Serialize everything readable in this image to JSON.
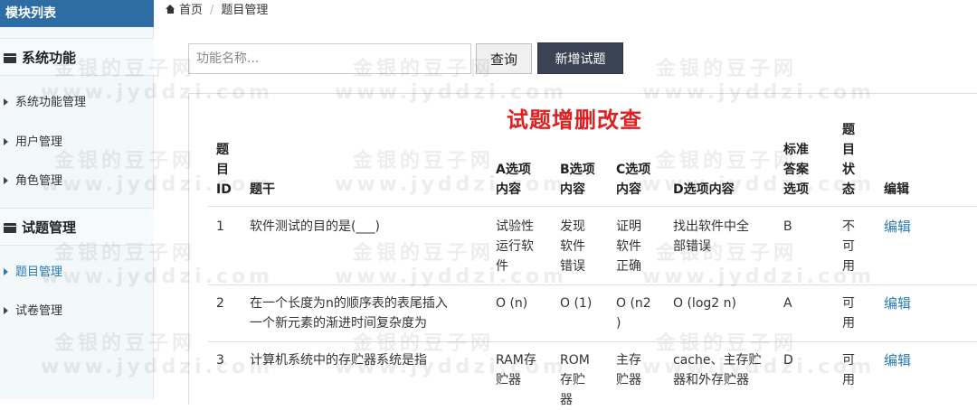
{
  "sidebar": {
    "header": "模块列表",
    "groups": [
      {
        "title": "系统功能",
        "items": [
          {
            "label": "系统功能管理"
          },
          {
            "label": "用户管理"
          },
          {
            "label": "角色管理"
          }
        ]
      },
      {
        "title": "试题管理",
        "items": [
          {
            "label": "题目管理"
          },
          {
            "label": "试卷管理"
          }
        ]
      }
    ]
  },
  "breadcrumb": {
    "home": "首页",
    "current": "题目管理"
  },
  "search": {
    "placeholder": "功能名称...",
    "query_label": "查询",
    "add_label": "新增试题"
  },
  "table": {
    "title": "试题增删改查",
    "headers": {
      "id": [
        "题",
        "目",
        "ID"
      ],
      "stem": "题干",
      "a": [
        "A选项",
        "内容"
      ],
      "b": [
        "B选项",
        "内容"
      ],
      "c": [
        "C选项",
        "内容"
      ],
      "d": "D选项内容",
      "answer": [
        "标准",
        "答案",
        "选项"
      ],
      "status": [
        "题",
        "目",
        "状",
        "态"
      ],
      "edit": "编辑"
    },
    "rows": [
      {
        "id": "1",
        "stem": [
          "软件测试的目的是(___)"
        ],
        "a": [
          "试验性",
          "运行软",
          "件"
        ],
        "b": [
          "发现",
          "软件",
          "错误"
        ],
        "c": [
          "证明",
          "软件",
          "正确"
        ],
        "d": [
          "找出软件中全",
          "部错误"
        ],
        "answer": "B",
        "status": [
          "不",
          "可",
          "用"
        ],
        "edit": "编辑"
      },
      {
        "id": "2",
        "stem": [
          "在一个长度为n的顺序表的表尾插入",
          "一个新元素的渐进时间复杂度为"
        ],
        "a": [
          "O (n)"
        ],
        "b": [
          "O (1)"
        ],
        "c": [
          "O (n2",
          ")"
        ],
        "d": [
          "O (log2 n)"
        ],
        "answer": "A",
        "status": [
          "可",
          "用"
        ],
        "edit": "编辑"
      },
      {
        "id": "3",
        "stem": [
          "计算机系统中的存贮器系统是指"
        ],
        "a": [
          "RAM存",
          "贮器"
        ],
        "b": [
          "ROM",
          "存贮",
          "器"
        ],
        "c": [
          "主存",
          "贮器"
        ],
        "d": [
          "cache、主存贮",
          "器和外存贮器"
        ],
        "answer": "D",
        "status": [
          "可",
          "用"
        ],
        "edit": "编辑"
      }
    ]
  },
  "watermark": {
    "cn": "金银的豆子网",
    "en": "www.jyddzi.com"
  }
}
